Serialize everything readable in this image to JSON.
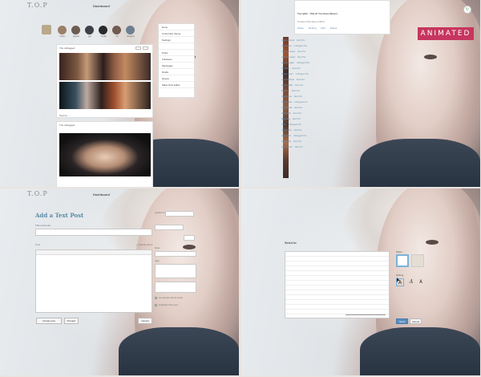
{
  "header": {
    "logo": "T.O.P",
    "dashboard": "Dashboard"
  },
  "friends": [
    "bbarry",
    "garuka",
    "gyo",
    "mortia",
    "rfp",
    "dragonly"
  ],
  "menu": [
    "Done",
    "Customize theme",
    "Settings",
    "",
    "Posts",
    "Followers",
    "Messages",
    "Drafts",
    "Queue",
    "Mass Post Editor"
  ],
  "posts": [
    {
      "user": "The reblogged",
      "suffix": "@"
    },
    {
      "user": "The reblogged",
      "suffix": "@"
    }
  ],
  "post_footer": "Source: ...",
  "post_tags": "notes",
  "activity": {
    "header": "Top Q&A - Title (If You Have Music)",
    "meta": "Posted 9 Monday at 9PM",
    "tools": [
      "Share",
      "Reblog",
      "Edit",
      "Delete"
    ],
    "rows": [
      {
        "who": "hayamedimus",
        "what": "liked this"
      },
      {
        "who": "ellonylaron",
        "what": "reblogged this"
      },
      {
        "who": "cathryne-stupo",
        "what": "liked this"
      },
      {
        "who": "cathryne-stupo",
        "what": "liked this"
      },
      {
        "who": "seoulyoungjin",
        "what": "reblogged this"
      },
      {
        "who": "tokyoboy",
        "what": "liked this"
      },
      {
        "who": "bbang-boom",
        "what": "reblogged this"
      },
      {
        "who": "yoyomadness",
        "what": "liked this"
      },
      {
        "who": "tomorrowlife",
        "what": "liked this"
      },
      {
        "who": "ibigbang",
        "what": "liked this"
      },
      {
        "who": "moonstone",
        "what": "liked this"
      },
      {
        "who": "thetopbasis",
        "what": "reblogged this"
      },
      {
        "who": "neverisland",
        "what": "liked this"
      },
      {
        "who": "stayjewish",
        "what": "liked this"
      },
      {
        "who": "bbigbang",
        "what": "liked this"
      },
      {
        "who": "chae",
        "what": "reblogged this"
      },
      {
        "who": "maybe-like",
        "what": "liked this"
      },
      {
        "who": "secretlove",
        "what": "reblogged this"
      },
      {
        "who": "onceagain",
        "what": "liked this"
      },
      {
        "who": "theresource",
        "what": "liked this"
      }
    ]
  },
  "badge": {
    "animated": "ANIMATED"
  },
  "text_post": {
    "title": "Add a Text Post",
    "title_label": "Title (optional)",
    "body_label": "Post",
    "rich_editor": "+ Upload photo",
    "publish_label": "publish now",
    "date_label": "Date",
    "tags_label": "tags",
    "options": [
      "Let people photo-reply",
      "Highlight this post"
    ],
    "create": "Create post",
    "preview": "Preview",
    "cancel": "Cancel"
  },
  "send_to": {
    "heading": "Send to",
    "paper_label": "Paper",
    "writing_label": "Writing",
    "fonts": [
      "A",
      "A",
      "A"
    ],
    "send": "Send",
    "cancel": "Cancel"
  }
}
